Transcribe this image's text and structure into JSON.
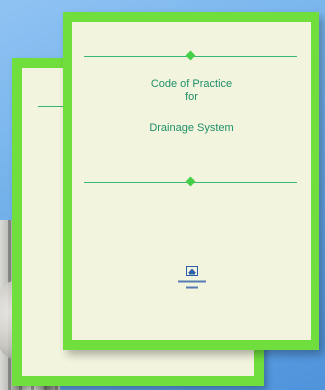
{
  "cover": {
    "title_line1": "Code of Practice",
    "title_line2": "for",
    "title_line3": "Drainage System"
  },
  "colors": {
    "background": "#6eaee9",
    "cover_border": "#70de3c",
    "cover_page": "#f3f4de",
    "title_text": "#1f8f6a",
    "rule": "#39b874"
  },
  "icons": {
    "department_logo": "building-emblem-icon"
  }
}
